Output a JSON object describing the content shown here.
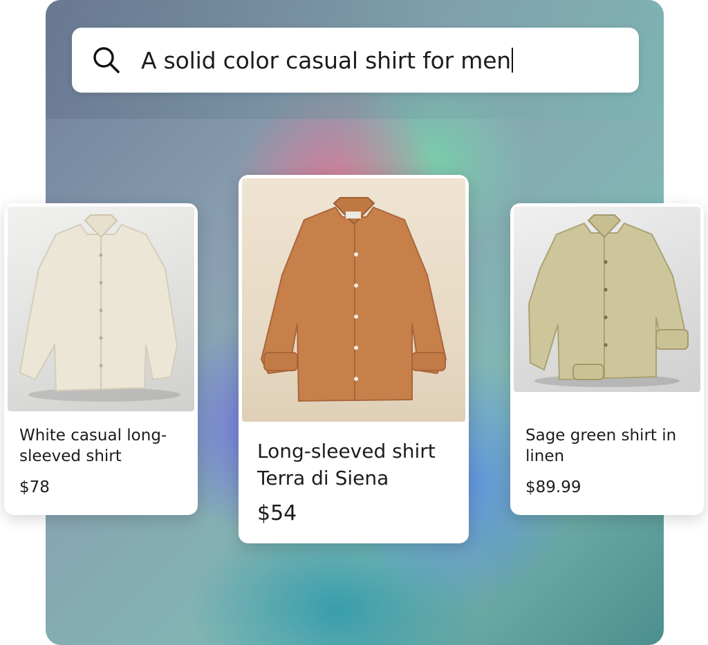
{
  "search": {
    "icon": "search-icon",
    "query": "A solid color casual shirt for men"
  },
  "products": [
    {
      "name": "White casual long-sleeved shirt",
      "price": "$78",
      "image": "white-linen-shirt-photo",
      "color": "#ece6d6"
    },
    {
      "name": "Long-sleeved shirt Terra di Siena",
      "price": "$54",
      "image": "terracotta-shirt-photo",
      "color": "#c8804b"
    },
    {
      "name": "Sage green shirt in linen",
      "price": "$89.99",
      "image": "sage-linen-shirt-photo",
      "color": "#cdc69a"
    }
  ]
}
